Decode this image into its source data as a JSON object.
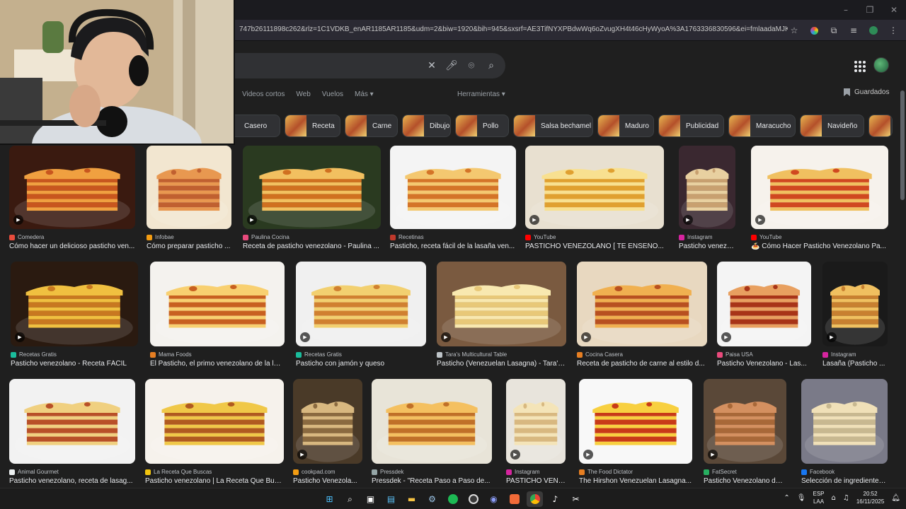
{
  "browser": {
    "url": "747b26111898c262&rlz=1C1VDKB_enAR1185AR1185&udm=2&biw=1920&bih=945&sxsrf=AE3TifNYXPBdwWq6oZvugXH4t46cHyWyoA%3A1763336830596&ei=fmlaadaMJKXW1sQPwvS...",
    "window_controls": [
      "–",
      "❐",
      "✕"
    ]
  },
  "search": {
    "nav_tabs": [
      "Videos cortos",
      "Web",
      "Vuelos",
      "Más ▾"
    ],
    "tools_label": "Herramientas ▾",
    "saved_label": "Guardados"
  },
  "chips": [
    "Casero",
    "Receta",
    "Carne",
    "Dibujo",
    "Pollo",
    "Salsa bechamel",
    "Maduro",
    "Publicidad",
    "Maracucho",
    "Navideño"
  ],
  "results": [
    {
      "source": "Comedera",
      "title": "Cómo hacer un delicioso pasticho ven...",
      "fav": "#e74c3c",
      "video": true
    },
    {
      "source": "Infobae",
      "title": "Cómo preparar pasticho ...",
      "fav": "#f39c12",
      "video": false
    },
    {
      "source": "Paulina Cocina",
      "title": "Receta de pasticho venezolano - Paulina ...",
      "fav": "#e84a7c",
      "video": true
    },
    {
      "source": "Recetinas",
      "title": "Pasticho, receta fácil de la lasaña ven...",
      "fav": "#c0392b",
      "video": false
    },
    {
      "source": "YouTube",
      "title": "PASTICHO VENEZOLANO [ TE ENSEÑO...",
      "fav": "#ff0000",
      "video": true
    },
    {
      "source": "Instagram",
      "title": "Pasticho venezola...",
      "fav": "#d6249f",
      "video": true
    },
    {
      "source": "YouTube",
      "title": "🍝 Cómo Hacer Pasticho Venezolano Pa...",
      "fav": "#ff0000",
      "video": true
    },
    {
      "source": "Recetas Gratis",
      "title": "Pasticho venezolano - Receta FÁCIL",
      "fav": "#1abc9c",
      "video": true
    },
    {
      "source": "Mama Foods",
      "title": "El Pasticho, el primo venezolano de la las...",
      "fav": "#e67e22",
      "video": false
    },
    {
      "source": "Recetas Gratis",
      "title": "Pasticho con jamón y queso",
      "fav": "#1abc9c",
      "video": true
    },
    {
      "source": "Tara's Multicultural Table",
      "title": "Pasticho (Venezuelan Lasagna) - Tara's...",
      "fav": "#bdc3c7",
      "video": true
    },
    {
      "source": "Cocina Casera",
      "title": "Receta de pasticho de carne al estilo d...",
      "fav": "#e67e22",
      "video": true
    },
    {
      "source": "Paisa USA",
      "title": "Pasticho Venezolano - Las...",
      "fav": "#e84a7c",
      "video": true
    },
    {
      "source": "Instagram",
      "title": "Lasaña (Pasticho ...",
      "fav": "#d6249f",
      "video": true
    },
    {
      "source": "Animal Gourmet",
      "title": "Pasticho venezolano, receta de lasag...",
      "fav": "#ecf0f1",
      "video": false
    },
    {
      "source": "La Receta Que Buscas",
      "title": "Pasticho venezolano | La Receta Que Bus...",
      "fav": "#f1c40f",
      "video": false
    },
    {
      "source": "cookpad.com",
      "title": "Pasticho Venezola...",
      "fav": "#f39c12",
      "video": true
    },
    {
      "source": "Pressdek",
      "title": "Pressdek - \"Receta Paso a Paso de...",
      "fav": "#95a5a6",
      "video": false
    },
    {
      "source": "Instagram",
      "title": "PASTICHO VENE...",
      "fav": "#d6249f",
      "video": true
    },
    {
      "source": "The Food Dictator",
      "title": "The Hirshon Venezuelan Lasagna...",
      "fav": "#e67e22",
      "video": true
    },
    {
      "source": "FatSecret",
      "title": "Pasticho Venezolano de ...",
      "fav": "#27ae60",
      "video": true
    },
    {
      "source": "Facebook",
      "title": "Selección de ingredientes...",
      "fav": "#1877f2",
      "video": false
    }
  ],
  "taskbar": {
    "lang_top": "ESP",
    "lang_bottom": "LAA",
    "time": "20:52",
    "date": "16/11/2025"
  }
}
